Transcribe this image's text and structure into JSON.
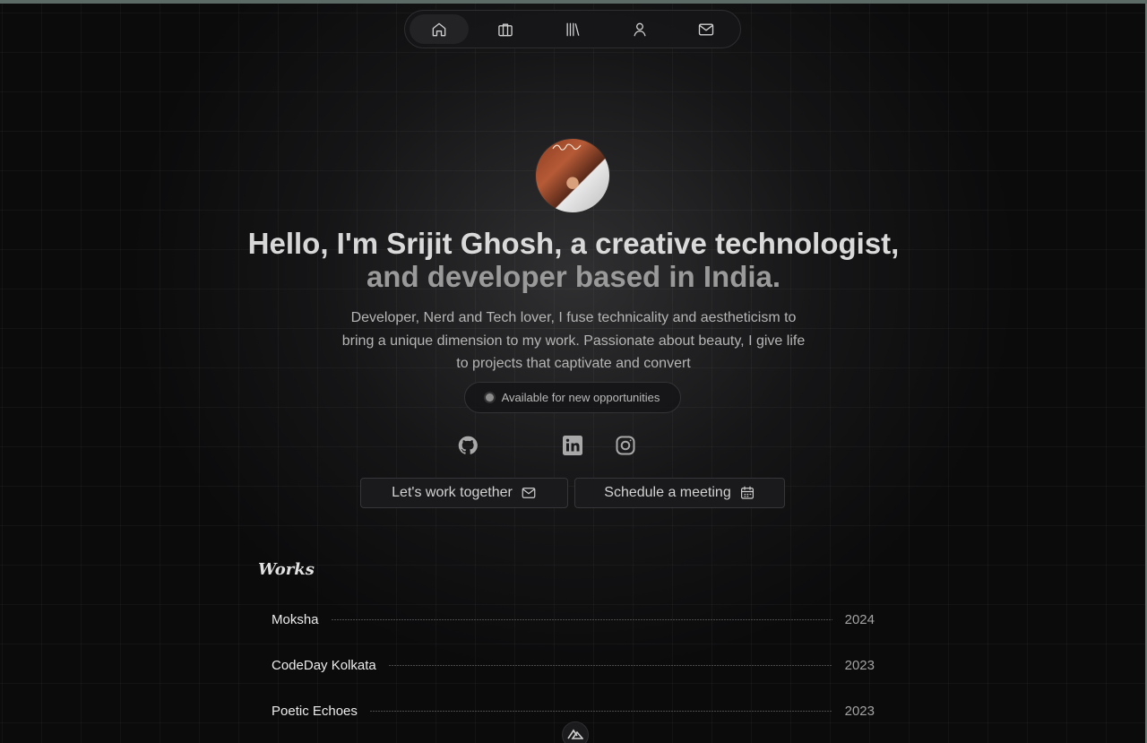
{
  "nav": {
    "items": [
      {
        "icon": "home-icon",
        "active": true
      },
      {
        "icon": "briefcase-icon",
        "active": false
      },
      {
        "icon": "library-icon",
        "active": false
      },
      {
        "icon": "user-icon",
        "active": false
      },
      {
        "icon": "mail-icon",
        "active": false
      }
    ]
  },
  "hero": {
    "greeting": "Hello, I'm ",
    "name": "Srijit Ghosh",
    "role_sep": ", a ",
    "role": "creative technologist,",
    "line2": "and developer based in India.",
    "intro": "Developer, Nerd and Tech lover, I fuse technicality and aestheticism to bring a unique dimension to my work. Passionate about beauty, I give life to projects that captivate and convert",
    "status": "Available for new opportunities"
  },
  "socials": [
    "github-icon",
    "linkedin-icon",
    "instagram-icon"
  ],
  "buttons": {
    "work": "Let's work together",
    "meeting": "Schedule a meeting"
  },
  "works": {
    "title": "Works",
    "items": [
      {
        "name": "Moksha",
        "year": "2024"
      },
      {
        "name": "CodeDay Kolkata",
        "year": "2023"
      },
      {
        "name": "Poetic Echoes",
        "year": "2023"
      }
    ]
  },
  "colors": {
    "background": "#0b0b0c",
    "text": "#d7d7d7",
    "muted": "#9a9a9a"
  }
}
